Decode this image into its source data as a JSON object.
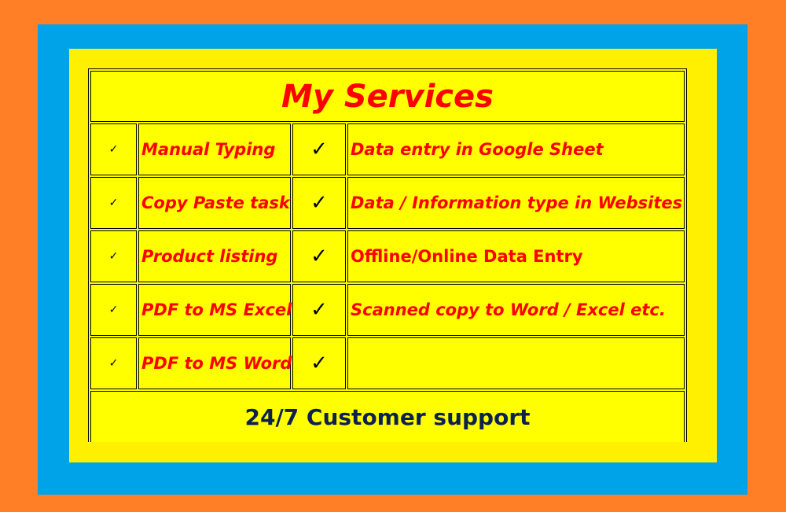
{
  "title": "My Services",
  "check_icon": "check-icon",
  "colors": {
    "background": "#FF7F27",
    "frame": "#00A2E8",
    "panel": "#FFEF00",
    "table": "#FFFF00",
    "service_text": "#FF0000",
    "footer_text": "#0D2050"
  },
  "rows": [
    {
      "left": "Manual Typing",
      "right": "Data entry in Google Sheet"
    },
    {
      "left": "Copy Paste task",
      "right": "Data / Information type in Websites"
    },
    {
      "left": "Product listing",
      "right": "Offline/Online Data Entry"
    },
    {
      "left": "PDF to MS Excel",
      "right": "Scanned copy to Word / Excel etc."
    },
    {
      "left": "PDF to MS Word",
      "right": ""
    }
  ],
  "footer": "24/7 Customer support"
}
